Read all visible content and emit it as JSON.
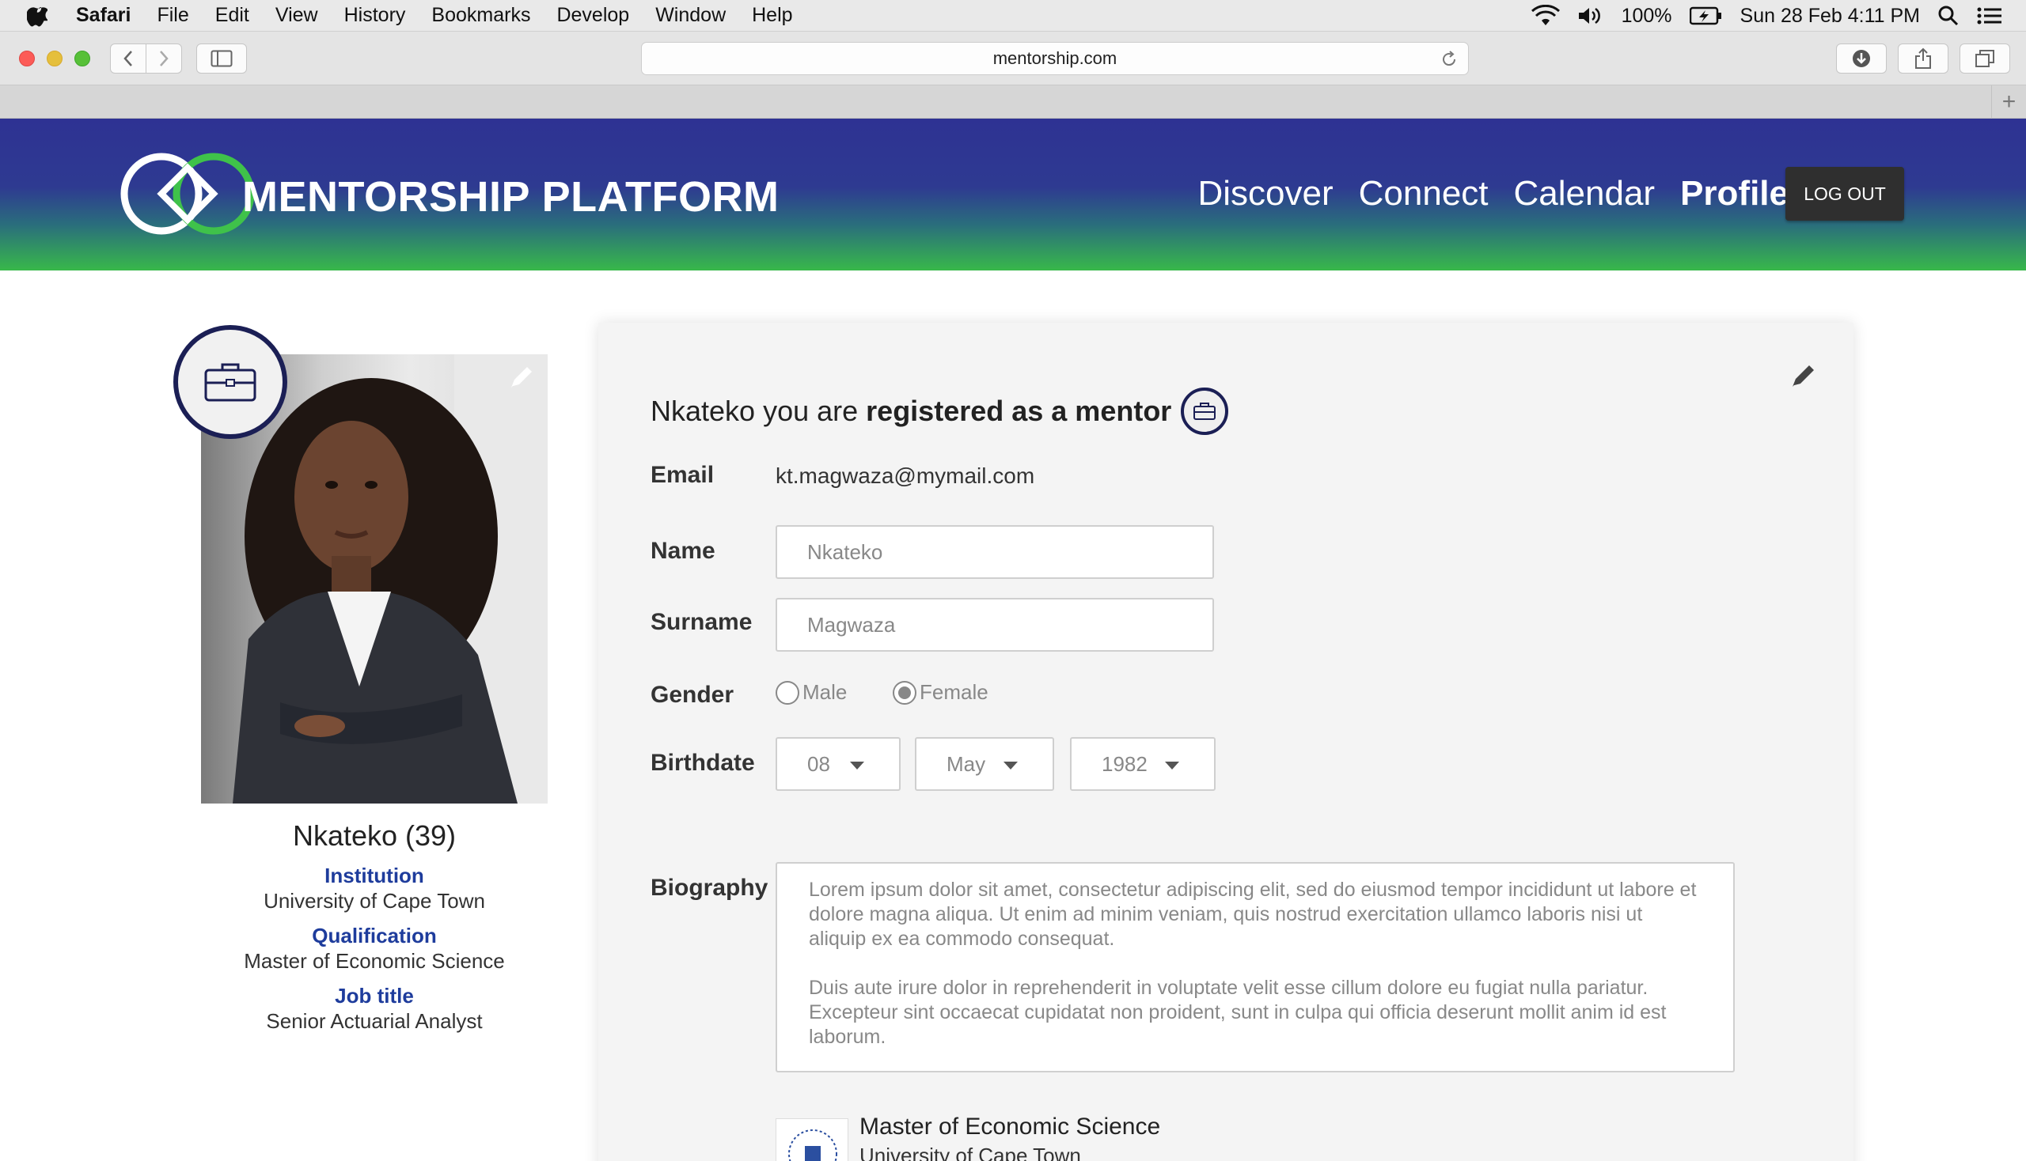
{
  "menubar": {
    "app": "Safari",
    "items": [
      "File",
      "Edit",
      "View",
      "History",
      "Bookmarks",
      "Develop",
      "Window",
      "Help"
    ],
    "battery": "100%",
    "datetime": "Sun 28 Feb  4:11 PM"
  },
  "browser": {
    "url": "mentorship.com"
  },
  "site": {
    "brand": "MENTORSHIP PLATFORM",
    "nav": [
      "Discover",
      "Connect",
      "Calendar",
      "Profile"
    ],
    "logout": "LOG OUT",
    "colors": {
      "header_top": "#2e3293",
      "header_bottom": "#38b84a",
      "accent_label": "#1e3c9c"
    }
  },
  "profile": {
    "name": "Nkateko (39)",
    "institution_label": "Institution",
    "institution": "University of Cape Town",
    "qualification_label": "Qualification",
    "qualification": "Master of Economic Science",
    "job_label": "Job title",
    "job": "Senior Actuarial Analyst"
  },
  "form": {
    "heading_prefix": "Nkateko you are",
    "heading_strong": "registered as a mentor",
    "email_label": "Email",
    "email": "kt.magwaza@mymail.com",
    "name_label": "Name",
    "name_value": "Nkateko",
    "surname_label": "Surname",
    "surname_value": "Magwaza",
    "gender_label": "Gender",
    "gender_male": "Male",
    "gender_female": "Female",
    "birthdate_label": "Birthdate",
    "day": "08",
    "month": "May",
    "year": "1982",
    "biography_label": "Biography",
    "bio_p1": "Lorem ipsum dolor sit amet, consectetur adipiscing elit, sed do eiusmod tempor incididunt ut labore et dolore magna aliqua. Ut enim ad minim veniam, quis nostrud exercitation ullamco laboris nisi ut aliquip ex ea commodo consequat.",
    "bio_p2": "Duis aute irure dolor in reprehenderit in voluptate velit esse cillum dolore eu fugiat nulla pariatur. Excepteur sint occaecat cupidatat non proident, sunt in culpa qui officia deserunt mollit anim id est laborum.",
    "qual_title": "Master of Economic Science",
    "qual_institution": "University of Cape Town"
  }
}
